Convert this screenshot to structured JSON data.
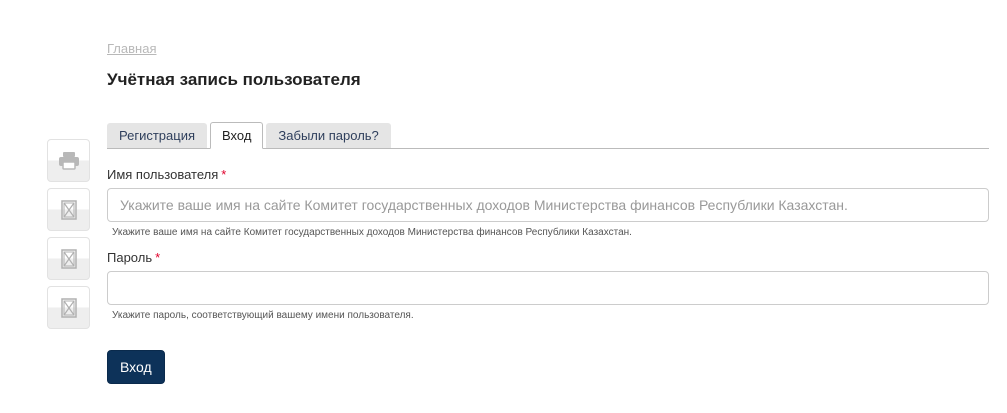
{
  "breadcrumb": {
    "home_label": "Главная"
  },
  "page": {
    "title": "Учётная запись пользователя"
  },
  "tabs": [
    {
      "label": "Регистрация",
      "active": false
    },
    {
      "label": "Вход",
      "active": true
    },
    {
      "label": "Забыли пароль?",
      "active": false
    }
  ],
  "form": {
    "username": {
      "label": "Имя пользователя",
      "required_marker": "*",
      "placeholder": "Укажите ваше имя на сайте Комитет государственных доходов Министерства финансов Республики Казахстан.",
      "value": "",
      "description": "Укажите ваше имя на сайте Комитет государственных доходов Министерства финансов Республики Казахстан."
    },
    "password": {
      "label": "Пароль",
      "required_marker": "*",
      "value": "",
      "description": "Укажите пароль, соответствующий вашему имени пользователя."
    },
    "submit_label": "Вход"
  },
  "side_toolbar": {
    "icons": [
      "print-icon",
      "broken-image-icon",
      "broken-image-icon",
      "broken-image-icon"
    ]
  },
  "colors": {
    "primary_button": "#0d3259",
    "required": "#e0002b",
    "tab_text": "#2f3f5c"
  }
}
